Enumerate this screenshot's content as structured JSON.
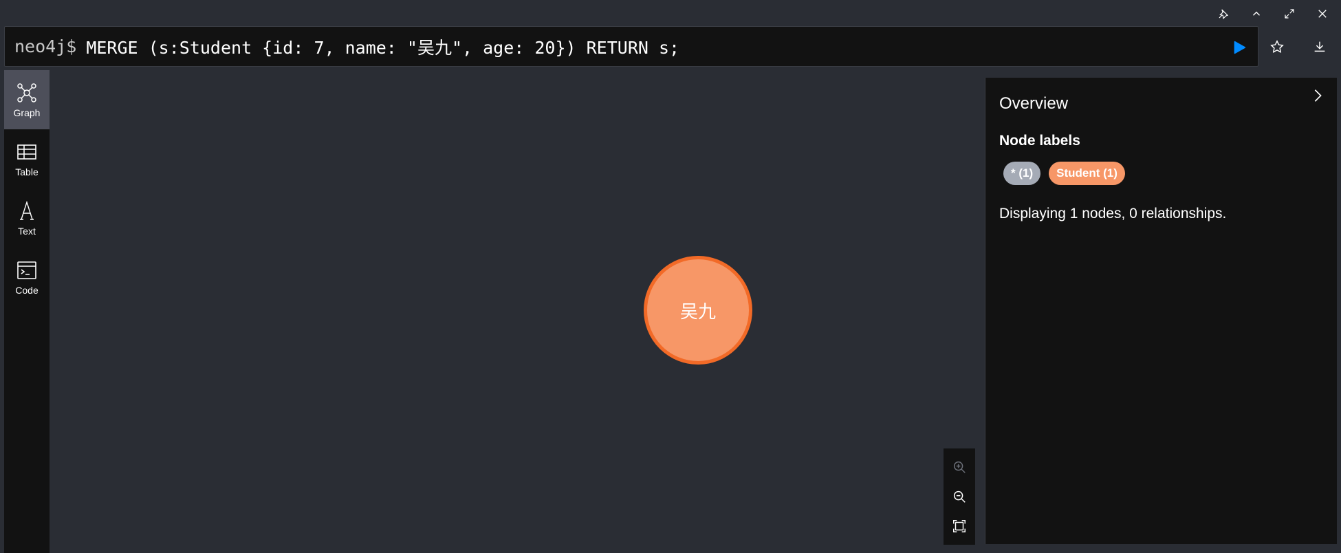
{
  "window": {
    "controls": [
      {
        "name": "pin-icon"
      },
      {
        "name": "collapse-up-icon"
      },
      {
        "name": "fullscreen-icon"
      },
      {
        "name": "close-icon"
      }
    ]
  },
  "editor": {
    "prompt": "neo4j$",
    "query": "MERGE (s:Student {id: 7, name: \"吴九\", age: 20}) RETURN s;",
    "actions": [
      {
        "name": "favorite-star-icon"
      },
      {
        "name": "download-icon"
      }
    ]
  },
  "sidebar": {
    "items": [
      {
        "label": "Graph",
        "icon": "graph-icon",
        "active": true
      },
      {
        "label": "Table",
        "icon": "table-icon",
        "active": false
      },
      {
        "label": "Text",
        "icon": "text-icon",
        "active": false
      },
      {
        "label": "Code",
        "icon": "code-icon",
        "active": false
      }
    ]
  },
  "graph": {
    "nodes": [
      {
        "caption": "吴九",
        "label": "Student",
        "color": "#f79767",
        "border": "#f26a27"
      }
    ]
  },
  "zoom": {
    "buttons": [
      {
        "name": "zoom-in-icon"
      },
      {
        "name": "zoom-out-icon"
      },
      {
        "name": "fit-to-screen-icon"
      }
    ]
  },
  "overview": {
    "title": "Overview",
    "node_labels_title": "Node labels",
    "chips": [
      {
        "text": "* (1)",
        "color": "#a5abb6"
      },
      {
        "text": "Student (1)",
        "color": "#f79767"
      }
    ],
    "summary": "Displaying 1 nodes, 0 relationships."
  },
  "colors": {
    "background": "#2a2d34",
    "panel": "#121212",
    "run_accent": "#018bff"
  }
}
